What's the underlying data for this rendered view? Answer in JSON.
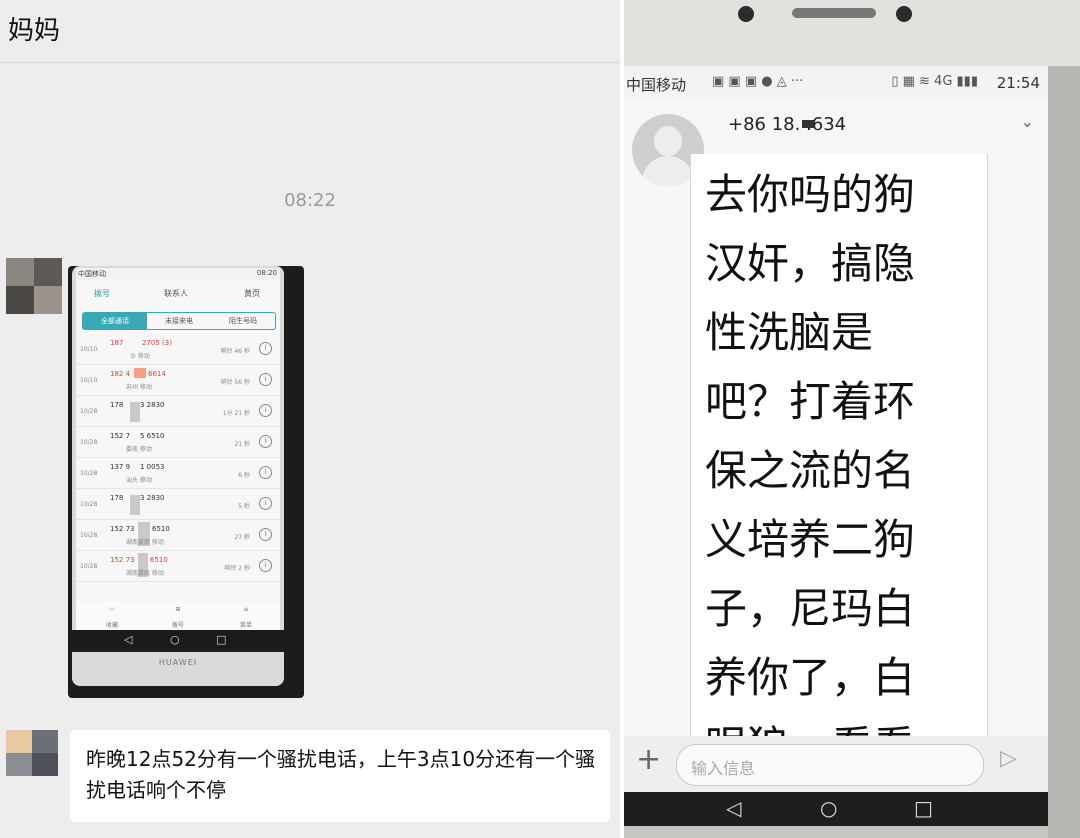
{
  "left": {
    "chat_title": "妈妈",
    "timestamp": "08:22",
    "phone_screenshot": {
      "status_carrier": "中国移动",
      "status_time": "08:20",
      "tabs": [
        "拨号",
        "联系人",
        "黄页"
      ],
      "segments": [
        "全部通话",
        "未接来电",
        "陌生号码"
      ],
      "calls": [
        {
          "date": "10/10",
          "number": "187",
          "number2": "2705 (3)",
          "location": "沙 移动",
          "duration": "响铃 46 秒",
          "missed": true
        },
        {
          "date": "10/10",
          "number": "182 4",
          "number2": "6614",
          "location": "苏州 移动",
          "duration": "响铃 56 秒",
          "missed": true
        },
        {
          "date": "10/28",
          "number": "178",
          "number2": "3 2830",
          "location": "",
          "duration": "1分 21 秒",
          "missed": false
        },
        {
          "date": "10/28",
          "number": "152 7",
          "number2": "5 6510",
          "location": "娄底 移动",
          "duration": "21 秒",
          "missed": false
        },
        {
          "date": "10/28",
          "number": "137 9",
          "number2": "1 0053",
          "location": "汕头 移动",
          "duration": "6 秒",
          "missed": false
        },
        {
          "date": "10/28",
          "number": "178",
          "number2": "3 2830",
          "location": "",
          "duration": "5 秒",
          "missed": false
        },
        {
          "date": "10/28",
          "number": "152 73",
          "number2": "6510",
          "location": "湖南娄底 移动",
          "duration": "27 秒",
          "missed": false
        },
        {
          "date": "10/28",
          "number": "152 73",
          "number2": "6510",
          "location": "湖南娄底 移动",
          "duration": "响铃 2 秒",
          "missed": true
        }
      ],
      "bottom_tabs": [
        "收藏",
        "拨号",
        "菜单"
      ],
      "brand": "HUAWEI"
    },
    "message_text": "昨晚12点52分有一个骚扰电话，上午3点10分还有一个骚扰电话响个不停"
  },
  "right": {
    "status": {
      "carrier": "中国移动",
      "time": "21:54",
      "icons_left": "▣ ▣ ▣ ● ◬ ···",
      "icons_right": "▯ ▦ ≋ 4G ▮▮▮"
    },
    "sender_number": "+86 18.       .634",
    "message_text": "去你吗的狗汉奸，搞隐性洗脑是吧？打着环保之流的名义培养二狗子，尼玛白养你了，白眼狼，看看",
    "input_placeholder": "输入信息",
    "icons": {
      "add": "plus-icon",
      "send": "send-icon",
      "back": "back-icon",
      "home": "home-icon",
      "recents": "recents-icon"
    }
  }
}
